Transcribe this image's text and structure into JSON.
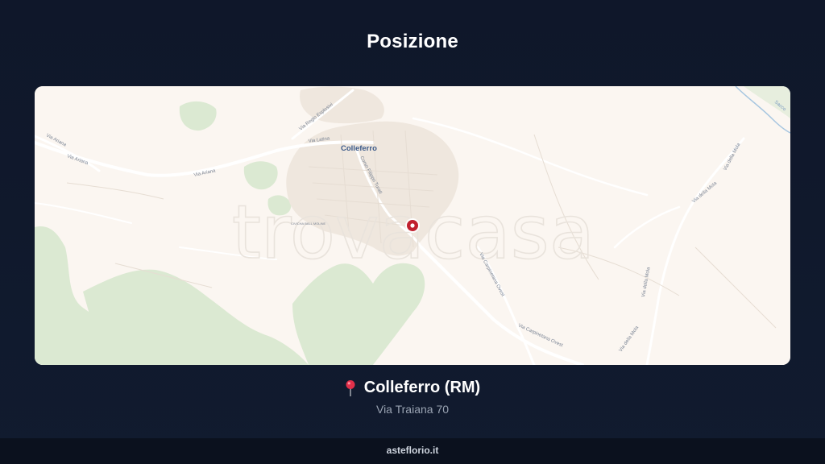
{
  "header": {
    "title": "Posizione"
  },
  "map": {
    "watermark": "trovacasa",
    "labels": {
      "town": "Colleferro",
      "via_regio_esplosivi": "Via Regio Esplosivi",
      "via_latina": "Via Latina",
      "via_ariana_1": "Via Ariana",
      "via_ariana_2": "Via Ariana",
      "via_ariana_3": "Via Ariana",
      "corso_turati": "Corso Filippo Turati",
      "via_carpinetana_1": "Via Carpinetana Ovest",
      "via_carpinetana_2": "Via Carpinetana Ovest",
      "via_della_mola_1": "Via della Mola",
      "via_della_mola_2": "Via della Mola",
      "via_della_mola_3": "Via della Mola",
      "via_della_mola_4": "Via della Mola",
      "sacco": "Sacco",
      "poi_small": "CIVICHA BALL MOLINE"
    },
    "colors": {
      "land": "#fbf6f1",
      "park": "#d9e8cf",
      "road": "#ffffff",
      "marker": "#c0202e"
    }
  },
  "location": {
    "city": "Colleferro (RM)",
    "address": "Via Traiana 70",
    "icon": "map-pin-icon"
  },
  "footer": {
    "brand": "asteflorio.it"
  }
}
